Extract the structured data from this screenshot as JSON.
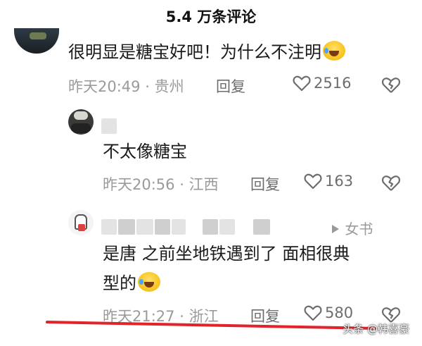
{
  "header": {
    "title": "5.4 万条评论"
  },
  "comments": [
    {
      "text": "很明显是糖宝好吧！为什么不注明",
      "emoji": "crying-laughing-face",
      "time": "昨天20:49",
      "location": "贵州",
      "reply_label": "回复",
      "likes": "2516"
    },
    {
      "text": "不太像糖宝",
      "time": "昨天20:56",
      "location": "江西",
      "reply_label": "回复",
      "likes": "163"
    },
    {
      "text_line1": "是唐 之前坐地铁遇到了 面相很典",
      "text_line2": "型的",
      "emoji": "crying-laughing-face",
      "reply_to": "女书",
      "time": "昨天21:27",
      "location": "浙江",
      "reply_label": "回复",
      "likes": "580"
    }
  ],
  "separator": "·",
  "watermark": "头条 @韩喜豪",
  "colors": {
    "annotation_line": "#e0242b",
    "meta_text": "#9a9a9a"
  },
  "icons": [
    "heart-icon",
    "broken-heart-icon",
    "play-triangle-icon"
  ]
}
